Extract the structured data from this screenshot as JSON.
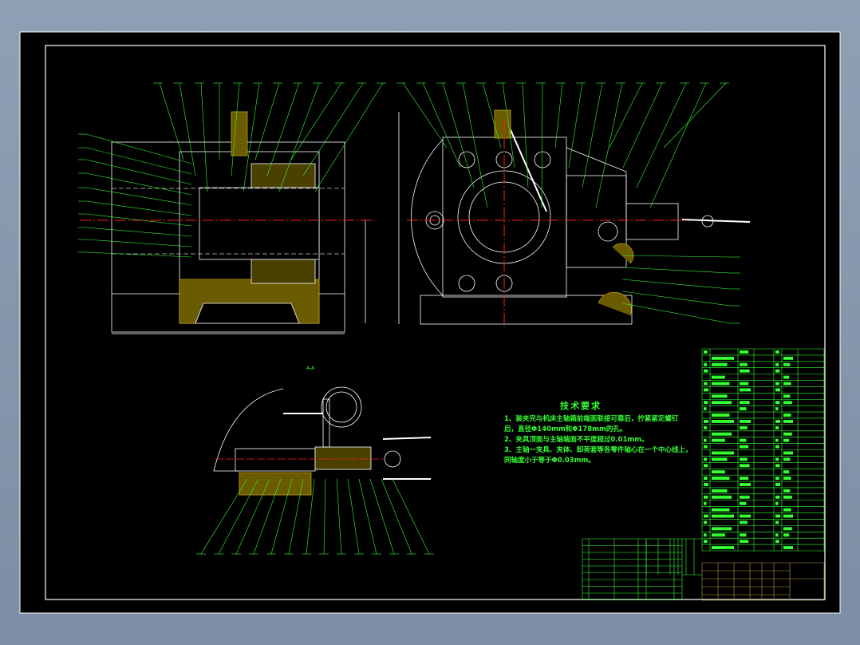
{
  "drawing": {
    "section_label": "A-A",
    "tech_requirements": {
      "title": "技术要求",
      "lines": [
        "1、装夹完与机床主轴箱前端面联接可靠后，拧紧紧定螺钉",
        "后，直径Φ140mm和Φ178mm的孔。",
        "2、夹具顶面与主轴端面不平度超过0.01mm。",
        "3、主轴一夹具、夹体、卸荷套等各零件轴心在一个中心线上，",
        "同轴度小于等于Φ0.03mm。"
      ]
    },
    "colors": {
      "line": "#ffffff",
      "text": "#33ff33",
      "centerline": "#ff2020",
      "hatch": "#c8a000",
      "frame": "#ffffff",
      "table": "#b8a040"
    }
  }
}
